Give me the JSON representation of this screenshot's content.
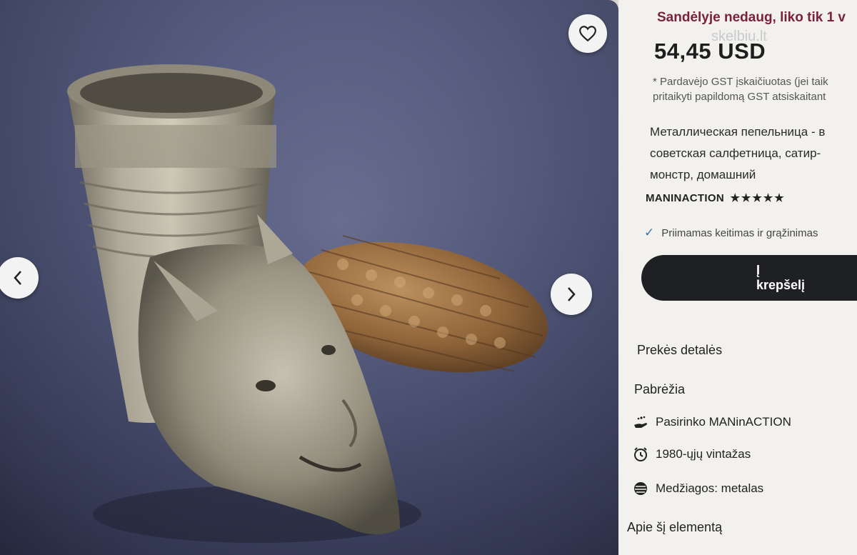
{
  "gallery": {
    "favorite_icon": "heart-icon",
    "prev_icon": "chevron-left-icon",
    "next_icon": "chevron-right-icon"
  },
  "panel": {
    "stock_notice": "Sandėlyje nedaug, liko tik 1 v",
    "watermark": "skelbiu.lt",
    "price": "54,45 USD",
    "gst_line1": "* Pardavėjo GST įskaičiuotas (jei taik",
    "gst_line2": "pritaikyti papildomą GST atsiskaitant",
    "title_line1": "Металлическая пепельница - в",
    "title_line2": "советская салфетница, сатир-",
    "title_line3": "монстр, домашний",
    "shop_name": "MANINACTION",
    "rating_stars": "★★★★★",
    "returns_text": "Priimamas keitimas ir grąžinimas",
    "add_to_cart": "Į krepšelį",
    "details_heading": "Prekės detalės",
    "highlights_heading": "Pabrėžia",
    "highlights": [
      {
        "icon": "hand-sparkle-icon",
        "text": "Pasirinko MANinACTION"
      },
      {
        "icon": "alarm-clock-icon",
        "text": "1980-ųjų vintažas"
      },
      {
        "icon": "material-swatch-icon",
        "text": "Medžiagos: metalas"
      }
    ],
    "about_heading": "Apie šį elementą"
  },
  "colors": {
    "stock_text": "#7b2140",
    "cart_button": "#1f2024",
    "check": "#3a6fb3"
  }
}
